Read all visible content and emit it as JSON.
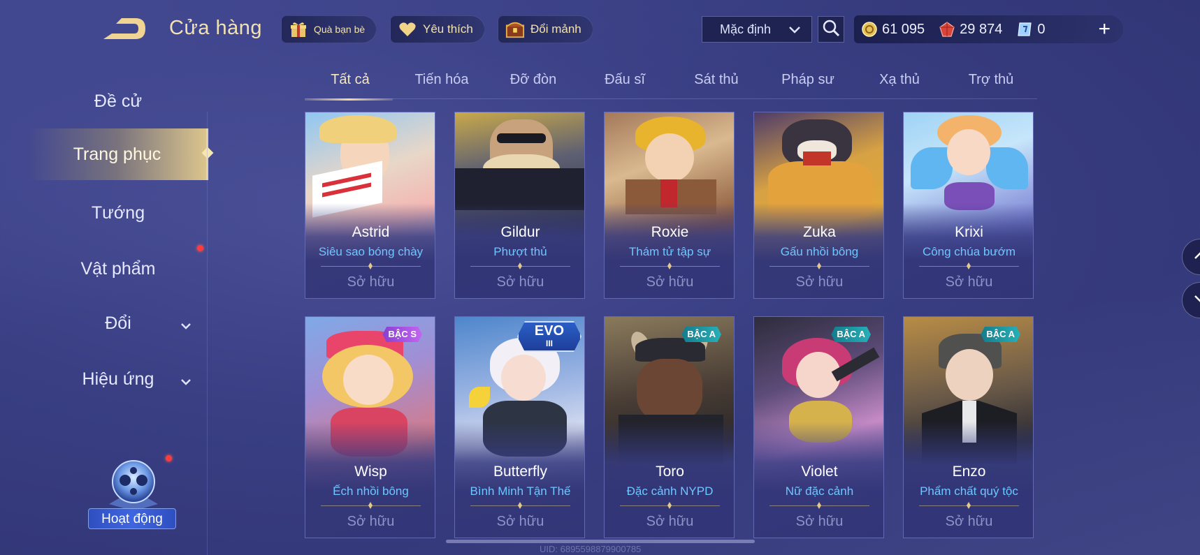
{
  "header": {
    "title": "Cửa hàng",
    "chips": {
      "gift": "Quà bạn bè",
      "favorite": "Yêu thích",
      "shard": "Đổi mảnh"
    },
    "sort": {
      "selected": "Mặc định"
    },
    "currency": {
      "coins": "61 095",
      "gems": "29 874",
      "vouchers": "0"
    },
    "plus": "+"
  },
  "sidebar": {
    "items": [
      {
        "label": "Đề cử"
      },
      {
        "label": "Trang phục"
      },
      {
        "label": "Tướng"
      },
      {
        "label": "Vật phẩm"
      },
      {
        "label": "Đổi"
      },
      {
        "label": "Hiệu ứng"
      }
    ],
    "activity": "Hoạt động"
  },
  "tabs": [
    {
      "label": "Tất cả"
    },
    {
      "label": "Tiến hóa"
    },
    {
      "label": "Đỡ đòn"
    },
    {
      "label": "Đấu sĩ"
    },
    {
      "label": "Sát thủ"
    },
    {
      "label": "Pháp sư"
    },
    {
      "label": "Xạ thủ"
    },
    {
      "label": "Trợ thủ"
    }
  ],
  "skins": [
    {
      "hero": "Astrid",
      "skin": "Siêu sao bóng chày",
      "status": "Sở hữu",
      "badge": ""
    },
    {
      "hero": "Gildur",
      "skin": "Phượt thủ",
      "status": "Sở hữu",
      "badge": ""
    },
    {
      "hero": "Roxie",
      "skin": "Thám tử tập sự",
      "status": "Sở hữu",
      "badge": ""
    },
    {
      "hero": "Zuka",
      "skin": "Gấu nhồi bông",
      "status": "Sở hữu",
      "badge": ""
    },
    {
      "hero": "Krixi",
      "skin": "Công chúa bướm",
      "status": "Sở hữu",
      "badge": ""
    },
    {
      "hero": "Wisp",
      "skin": "Ếch nhồi bông",
      "status": "Sở hữu",
      "badge": "BẬC S"
    },
    {
      "hero": "Butterfly",
      "skin": "Bình Minh Tận Thế",
      "status": "Sở hữu",
      "badge": "EVO",
      "badge_level": "III"
    },
    {
      "hero": "Toro",
      "skin": "Đặc cảnh NYPD",
      "status": "Sở hữu",
      "badge": "BẬC A"
    },
    {
      "hero": "Violet",
      "skin": "Nữ đặc cảnh",
      "status": "Sở hữu",
      "badge": "BẬC A"
    },
    {
      "hero": "Enzo",
      "skin": "Phẩm chất quý tộc",
      "status": "Sở hữu",
      "badge": "BẬC A"
    }
  ],
  "footer": {
    "uid": "UID: 6895598879900785"
  },
  "colors": {
    "accent_gold": "#f1e2b4",
    "skin_name_blue": "#6fc6ff",
    "owned_gray": "#8e93c8",
    "notification_red": "#ff3b3b"
  },
  "icons": {
    "back": "back-arrow-icon",
    "gift": "gift-icon",
    "favorite": "heart-icon",
    "shard": "treasure-chest-icon",
    "search": "search-icon",
    "coin": "gold-coin-icon",
    "gem": "red-gem-icon",
    "voucher": "voucher-icon"
  }
}
